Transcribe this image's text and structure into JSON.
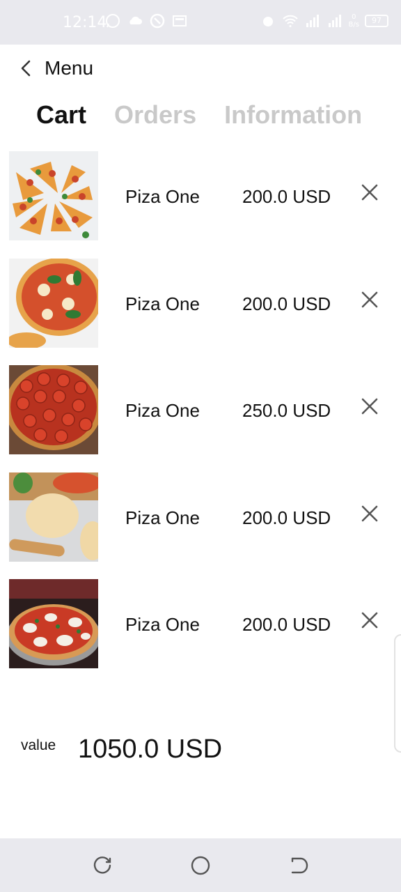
{
  "status_bar": {
    "time": "12:14",
    "network_speed": "0\nB/s",
    "battery_level": "97"
  },
  "header": {
    "back_label": "Menu"
  },
  "tabs": [
    {
      "label": "Cart",
      "active": true
    },
    {
      "label": "Orders",
      "active": false
    },
    {
      "label": "Information",
      "active": false
    }
  ],
  "cart": {
    "items": [
      {
        "name": "Piza One",
        "price": "200.0 USD",
        "image": "sliced-pizza-image"
      },
      {
        "name": "Piza One",
        "price": "200.0 USD",
        "image": "margherita-basil-pizza-image"
      },
      {
        "name": "Piza One",
        "price": "250.0 USD",
        "image": "pepperoni-pizza-image"
      },
      {
        "name": "Piza One",
        "price": "200.0 USD",
        "image": "pizza-dough-image"
      },
      {
        "name": "Piza One",
        "price": "200.0 USD",
        "image": "margherita-pizza-image"
      }
    ]
  },
  "total": {
    "label": "value",
    "amount": "1050.0 USD"
  },
  "colors": {
    "text": "#111111",
    "inactive_tab": "#c9c9c9",
    "system_bar": "#e9e9ee"
  }
}
